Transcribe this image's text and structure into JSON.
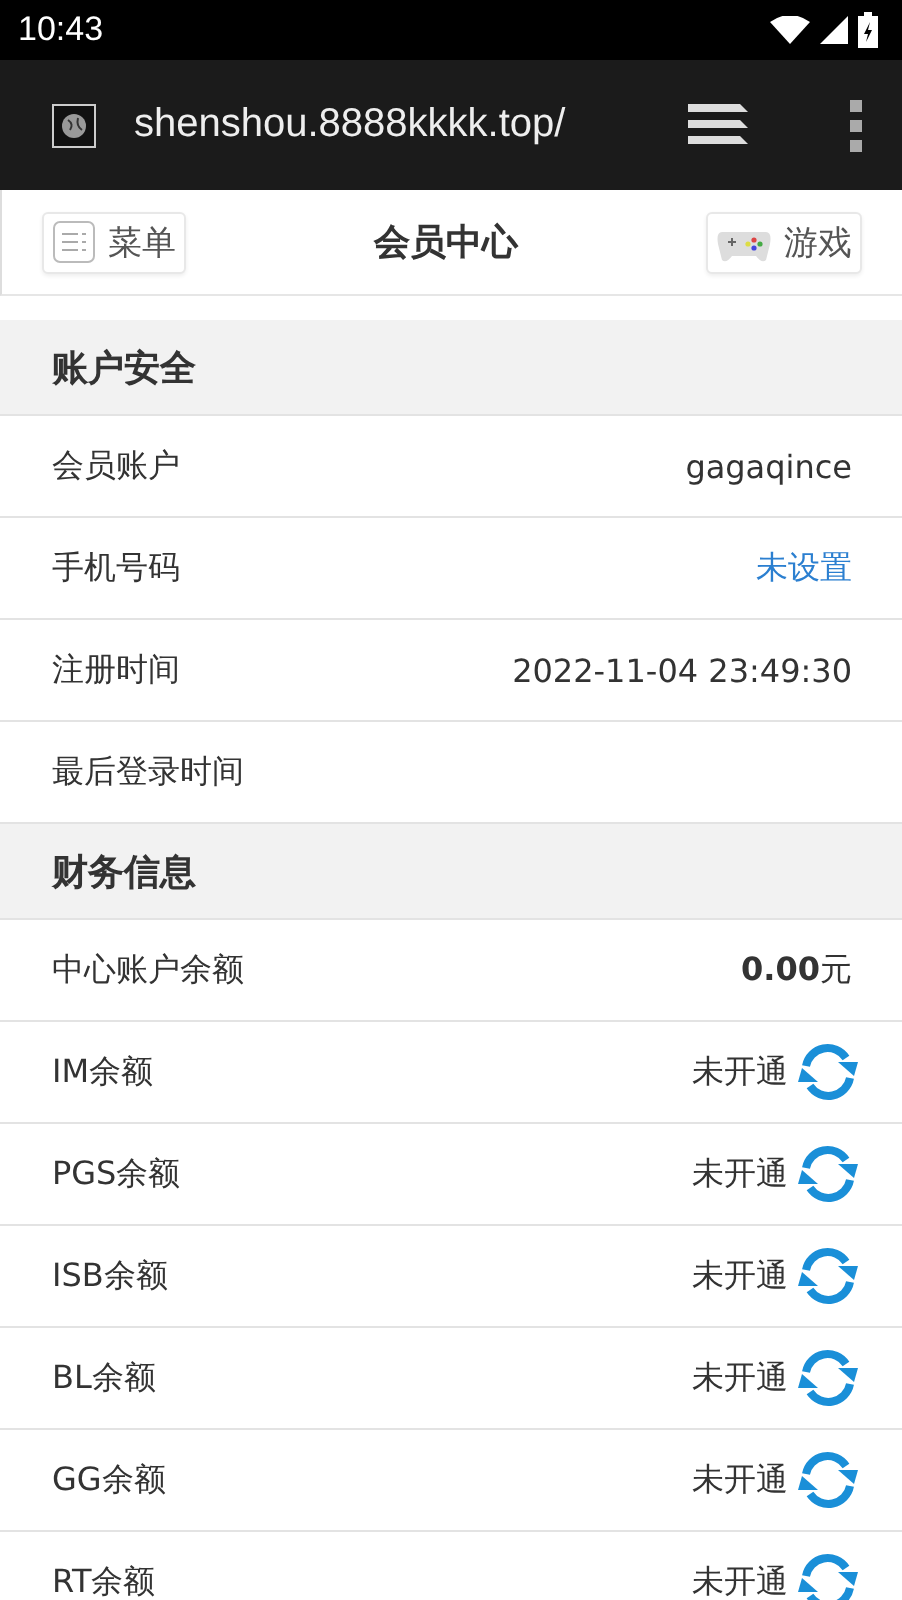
{
  "status_bar": {
    "time": "10:43"
  },
  "browser": {
    "url": "shenshou.8888kkkk.top/"
  },
  "header": {
    "menu_button": "菜单",
    "title": "会员中心",
    "games_button": "游戏"
  },
  "sections": [
    {
      "title": "账户安全",
      "rows": [
        {
          "kind": "text",
          "label": "会员账户",
          "value": "gagaqince"
        },
        {
          "kind": "link",
          "label": "手机号码",
          "value": "未设置"
        },
        {
          "kind": "text",
          "label": "注册时间",
          "value": "2022-11-04 23:49:30"
        },
        {
          "kind": "text",
          "label": "最后登录时间"
        }
      ]
    },
    {
      "title": "财务信息",
      "rows": [
        {
          "kind": "text",
          "label": "中心账户余额",
          "value": "**0.00**元"
        },
        {
          "kind": "refresh",
          "label": "IM余额",
          "value": "未开通"
        },
        {
          "kind": "refresh",
          "label": "PGS余额",
          "value": "未开通"
        },
        {
          "kind": "refresh",
          "label": "ISB余额",
          "value": "未开通"
        },
        {
          "kind": "refresh",
          "label": "BL余额",
          "value": "未开通"
        },
        {
          "kind": "refresh",
          "label": "GG余额",
          "value": "未开通"
        },
        {
          "kind": "refresh",
          "label": "RT余额",
          "value": "未开通"
        }
      ]
    }
  ]
}
